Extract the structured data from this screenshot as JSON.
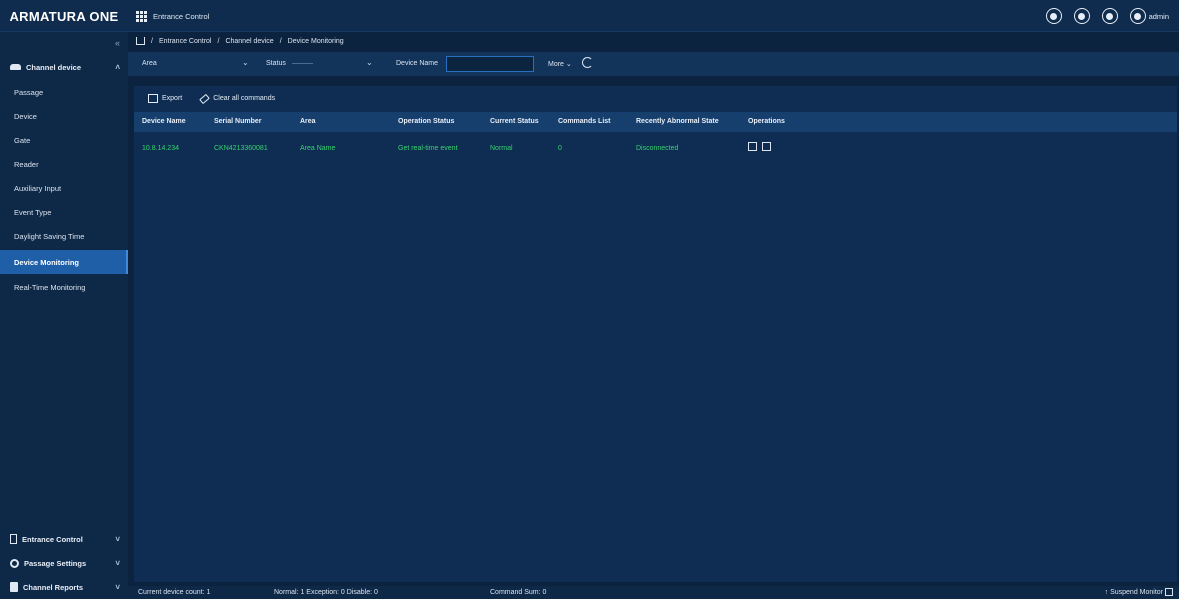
{
  "app": {
    "brand": "ARMATURA ONE",
    "module": "Entrance Control"
  },
  "header": {
    "user": "admin",
    "icons": [
      "language-icon",
      "notification-icon",
      "alarm-icon",
      "user-avatar-icon"
    ]
  },
  "sidebar": {
    "collapse_icon": "double-chevron-left-icon",
    "groups": [
      {
        "label": "Channel device",
        "icon": "car-icon",
        "expanded": true
      },
      {
        "label": "Entrance Control",
        "icon": "door-icon",
        "expanded": false
      },
      {
        "label": "Passage Settings",
        "icon": "gear-icon",
        "expanded": false
      },
      {
        "label": "Channel Reports",
        "icon": "report-icon",
        "expanded": false
      }
    ],
    "items": [
      {
        "label": "Passage"
      },
      {
        "label": "Device"
      },
      {
        "label": "Gate"
      },
      {
        "label": "Reader"
      },
      {
        "label": "Auxiliary Input"
      },
      {
        "label": "Event Type"
      },
      {
        "label": "Daylight Saving Time"
      },
      {
        "label": "Device Monitoring",
        "active": true
      },
      {
        "label": "Real-Time Monitoring"
      }
    ]
  },
  "breadcrumb": {
    "items": [
      "Entrance Control",
      "Channel device",
      "Device Monitoring"
    ],
    "separator": "/"
  },
  "filters": {
    "area_label": "Area",
    "status_label": "Status",
    "status_value": "———",
    "device_name_label": "Device Name",
    "device_name_value": "",
    "more_label": "More"
  },
  "toolbar": {
    "export_label": "Export",
    "clear_label": "Clear all commands"
  },
  "table": {
    "columns": [
      "Device Name",
      "Serial Number",
      "Area",
      "Operation Status",
      "Current Status",
      "Commands List",
      "Recently Abnormal State",
      "Operations"
    ],
    "rows": [
      {
        "device_name": "10.8.14.234",
        "serial": "CKN4213360081",
        "area": "Area Name",
        "operation_status": "Get real-time event",
        "current_status": "Normal",
        "commands": "0",
        "abnormal_state": "Disconnected"
      }
    ],
    "row_color": "#36d36f"
  },
  "footer": {
    "count": "Current device count:  1",
    "stats": "Normal:  1  Exception:  0  Disable:  0",
    "command_sum": "Command Sum:  0",
    "suspend": "Suspend Monitor"
  },
  "colors": {
    "accent": "#1f5fa8",
    "background": "#0c2340",
    "status_ok": "#36d36f"
  }
}
